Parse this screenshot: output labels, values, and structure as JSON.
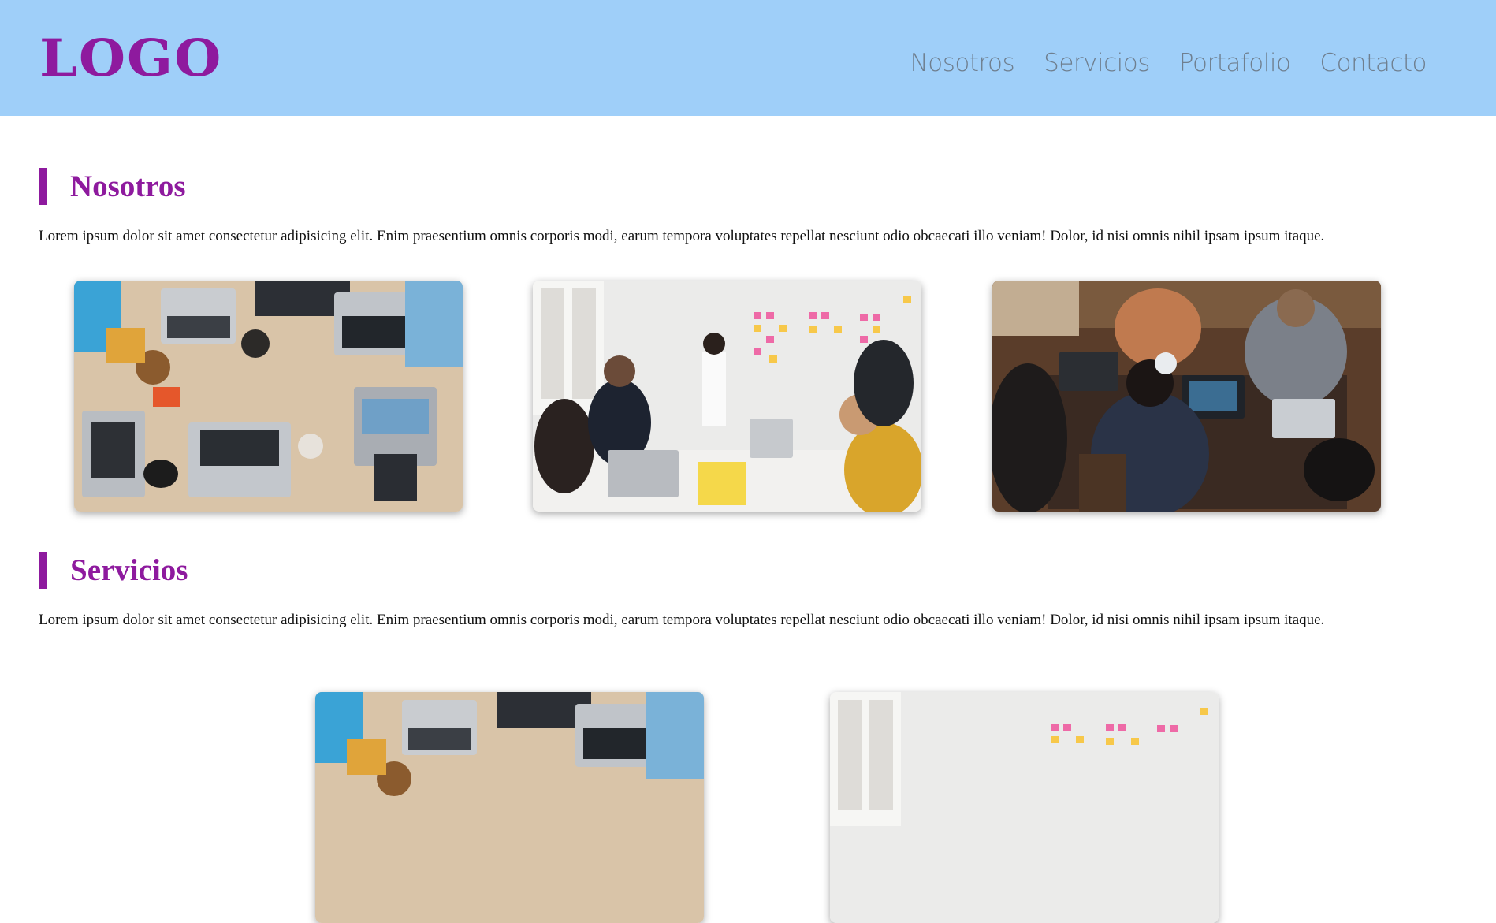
{
  "header": {
    "logo": "LOGO",
    "nav": [
      "Nosotros",
      "Servicios",
      "Portafolio",
      "Contacto"
    ]
  },
  "sections": [
    {
      "title": "Nosotros",
      "text": "Lorem ipsum dolor sit amet consectetur adipisicing elit. Enim praesentium omnis corporis modi, earum tempora voluptates repellat nesciunt odio obcaecati illo veniam! Dolor, id nisi omnis nihil ipsam ipsum itaque."
    },
    {
      "title": "Servicios",
      "text": "Lorem ipsum dolor sit amet consectetur adipisicing elit. Enim praesentium omnis corporis modi, earum tempora voluptates repellat nesciunt odio obcaecati illo veniam! Dolor, id nisi omnis nihil ipsam ipsum itaque."
    }
  ],
  "colors": {
    "header_bg": "#9fcff9",
    "accent": "#8e1a9e",
    "nav_text": "#6f7f8f"
  }
}
